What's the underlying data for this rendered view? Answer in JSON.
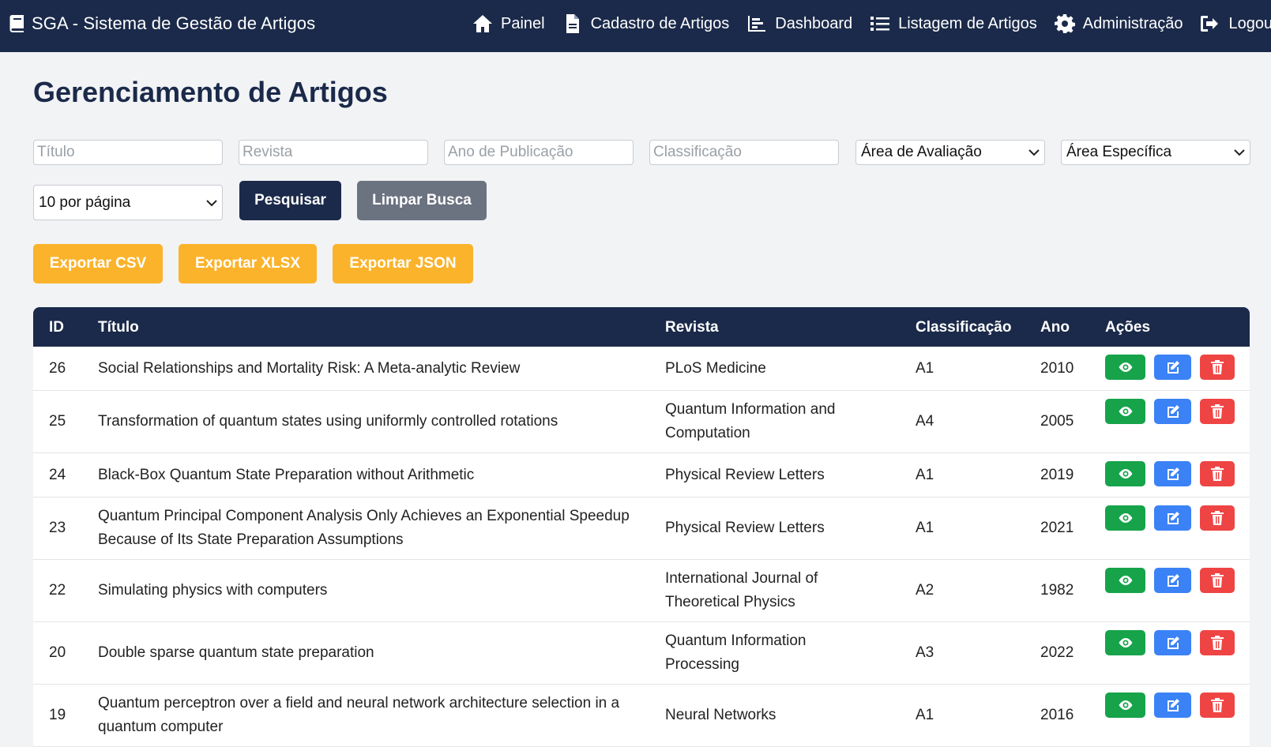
{
  "navbar": {
    "brand": "SGA - Sistema de Gestão de Artigos",
    "items": [
      {
        "label": "Painel",
        "icon": "home-icon"
      },
      {
        "label": "Cadastro de Artigos",
        "icon": "file-icon"
      },
      {
        "label": "Dashboard",
        "icon": "chart-icon"
      },
      {
        "label": "Listagem de Artigos",
        "icon": "list-icon"
      },
      {
        "label": "Administração",
        "icon": "gear-icon"
      },
      {
        "label": "Logout",
        "icon": "logout-icon"
      }
    ]
  },
  "page": {
    "title": "Gerenciamento de Artigos"
  },
  "filters": {
    "titulo_placeholder": "Título",
    "revista_placeholder": "Revista",
    "ano_placeholder": "Ano de Publicação",
    "classificacao_placeholder": "Classificação",
    "area_avaliacao": "Área de Avaliação",
    "area_especifica": "Área Específica",
    "per_page": "10 por página",
    "search_label": "Pesquisar",
    "clear_label": "Limpar Busca"
  },
  "export": {
    "csv": "Exportar CSV",
    "xlsx": "Exportar XLSX",
    "json": "Exportar JSON"
  },
  "colors": {
    "navy": "#1b2a4a",
    "orange": "#fbb32b",
    "green": "#16a34a",
    "blue": "#3b82f6",
    "red": "#ef4444"
  },
  "table": {
    "headers": {
      "id": "ID",
      "title": "Título",
      "journal": "Revista",
      "class": "Classificação",
      "year": "Ano",
      "actions": "Ações"
    },
    "rows": [
      {
        "id": "26",
        "title": "Social Relationships and Mortality Risk: A Meta-analytic Review",
        "journal": "PLoS Medicine",
        "class": "A1",
        "year": "2010"
      },
      {
        "id": "25",
        "title": "Transformation of quantum states using uniformly controlled rotations",
        "journal": "Quantum Information and Computation",
        "class": "A4",
        "year": "2005"
      },
      {
        "id": "24",
        "title": "Black-Box Quantum State Preparation without Arithmetic",
        "journal": "Physical Review Letters",
        "class": "A1",
        "year": "2019"
      },
      {
        "id": "23",
        "title": "Quantum Principal Component Analysis Only Achieves an Exponential Speedup Because of Its State Preparation Assumptions",
        "journal": "Physical Review Letters",
        "class": "A1",
        "year": "2021"
      },
      {
        "id": "22",
        "title": "Simulating physics with computers",
        "journal": "International Journal of Theoretical Physics",
        "class": "A2",
        "year": "1982"
      },
      {
        "id": "20",
        "title": "Double sparse quantum state preparation",
        "journal": "Quantum Information Processing",
        "class": "A3",
        "year": "2022"
      },
      {
        "id": "19",
        "title": "Quantum perceptron over a field and neural network architecture selection in a quantum computer",
        "journal": "Neural Networks",
        "class": "A1",
        "year": "2016"
      }
    ]
  }
}
